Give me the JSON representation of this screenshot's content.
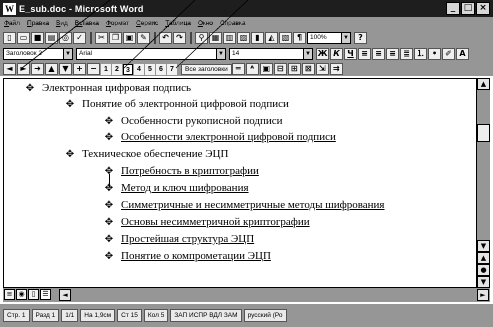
{
  "window": {
    "title": "Е_sub.doc - Microsoft Word",
    "app_icon": "W",
    "buttons": {
      "minimize": "_",
      "maximize": "□",
      "close": "×"
    }
  },
  "menu": {
    "items": [
      {
        "accel": "Ф",
        "rest": "айл"
      },
      {
        "accel": "П",
        "rest": "равка"
      },
      {
        "accel": "В",
        "rest": "ид"
      },
      {
        "accel": "Вс",
        "rest": "тавка"
      },
      {
        "accel": "Ф",
        "rest": "ормат"
      },
      {
        "accel": "С",
        "rest": "ервис"
      },
      {
        "accel": "Т",
        "rest": "аблица"
      },
      {
        "accel": "О",
        "rest": "кно"
      },
      {
        "accel": "?",
        "rest": "Справка"
      }
    ]
  },
  "toolbar_standard": {
    "zoom": "100%"
  },
  "toolbar_format": {
    "style": "Заголовок 2",
    "font": "Arial",
    "size": "14"
  },
  "toolbar_outline": {
    "levels": [
      "1",
      "2",
      "3",
      "4",
      "5",
      "6",
      "7"
    ],
    "active_level": "3",
    "show_all": "Все заголовки"
  },
  "document": {
    "lines": [
      {
        "symbol": "✥",
        "text": "Электронная цифровая подпись",
        "underlined": false
      },
      {
        "symbol": "✥",
        "text": "Понятие об электронной цифровой подписи",
        "underlined": false
      },
      {
        "symbol": "✥",
        "text": "Особенности рукописной подписи",
        "underlined": false
      },
      {
        "symbol": "✥",
        "text": "Особенности электронной цифровой подписи",
        "underlined": true
      },
      {
        "symbol": "✥",
        "text": "Техническое обеспечение ЭЦП",
        "underlined": false
      },
      {
        "symbol": "✥",
        "text": "Потребность в криптографии",
        "underlined": true
      },
      {
        "symbol": "✥",
        "text": "Метод и ключ шифрования",
        "underlined": true
      },
      {
        "symbol": "✥",
        "text": "Симметричные и несимметричные методы шифрования",
        "underlined": true
      },
      {
        "symbol": "✥",
        "text": "Основы несимметричной криптографии",
        "underlined": true
      },
      {
        "symbol": "✥",
        "text": "Простейшая структура ЭЦП",
        "underlined": true
      },
      {
        "symbol": "✥",
        "text": "Понятие о компрометации ЭЦП",
        "underlined": true
      }
    ]
  },
  "status": {
    "cells": [
      "Стр. 1",
      "Разд 1",
      "1/1",
      "На 1,9см",
      "Ст 15",
      "Кол 5",
      "ЗАП ИСПР ВДЛ ЗАМ",
      "русский (Ро"
    ]
  }
}
